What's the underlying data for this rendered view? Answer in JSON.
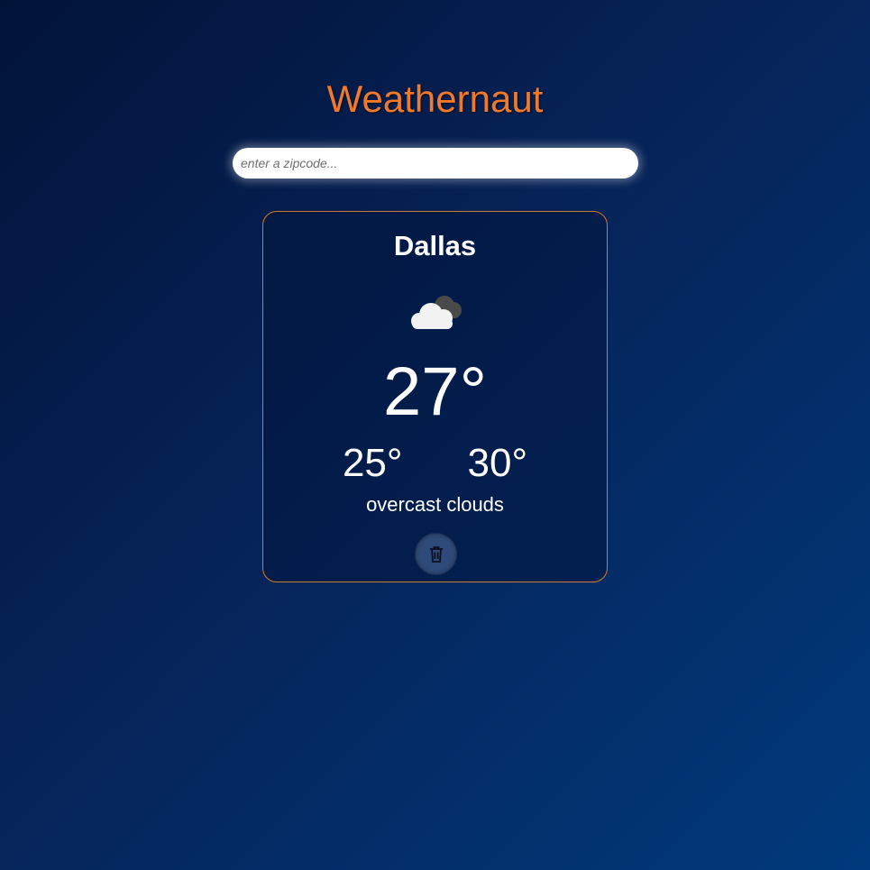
{
  "header": {
    "title": "Weathernaut"
  },
  "search": {
    "placeholder": "enter a zipcode...",
    "value": ""
  },
  "card": {
    "city": "Dallas",
    "icon": "overcast-clouds-icon",
    "current_temp": "27°",
    "min_temp": "25°",
    "max_temp": "30°",
    "description": "overcast clouds",
    "delete_icon": "trash-icon"
  },
  "colors": {
    "accent": "#f07a2a",
    "card_border": "#d27a2e",
    "background_dark": "#021338",
    "background_light": "#003a7c"
  }
}
